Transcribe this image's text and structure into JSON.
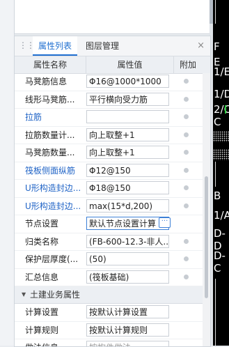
{
  "panel": {
    "tabs": [
      {
        "label": "属性列表",
        "active": true
      },
      {
        "label": "图层管理",
        "active": false
      }
    ],
    "close_glyph": "×",
    "grip_glyph": "⋮⋮"
  },
  "columns": {
    "name": "属性名称",
    "value": "属性值",
    "extra": "附加"
  },
  "rows": [
    {
      "name": "马凳筋信息",
      "value": "Φ16@1000*1000"
    },
    {
      "name": "线形马凳筋...",
      "value": "平行横向受力筋"
    },
    {
      "name": "拉筋",
      "value": ""
    },
    {
      "name": "拉筋数量计...",
      "value": "向上取整+1"
    },
    {
      "name": "马凳筋数量...",
      "value": "向上取整+1"
    },
    {
      "name": "筏板侧面纵筋",
      "value": "Φ12@150"
    },
    {
      "name": "U形构造封边...",
      "value": "Φ18@150"
    },
    {
      "name": "U形构造封边...",
      "value": "max(15*d,200)"
    },
    {
      "name": "节点设置",
      "value": "默认节点设置计算",
      "button": "···"
    },
    {
      "name": "归类名称",
      "value": "(FB-600-12.3-非人..."
    },
    {
      "name": "保护层厚度(...",
      "value": "(50)"
    },
    {
      "name": "汇总信息",
      "value": "(筏板基础)"
    }
  ],
  "section": {
    "arrow": "▼",
    "label": "土建业务属性"
  },
  "rows2": [
    {
      "name": "计算设置",
      "value": "按默认计算设置"
    },
    {
      "name": "计算规则",
      "value": "按默认计算规则"
    },
    {
      "name": "做法信息",
      "value": "按构件做法"
    }
  ],
  "cad_labels": [
    "F",
    "E",
    "1/E",
    "1/D",
    "2/C",
    "C",
    "B",
    "1/A",
    "D-D",
    "D-C"
  ],
  "colors": {
    "accent": "#1f6fd0",
    "link_blue": "#1f63c6",
    "cad_bg": "#000000",
    "panel_bg": "#ffffff"
  }
}
